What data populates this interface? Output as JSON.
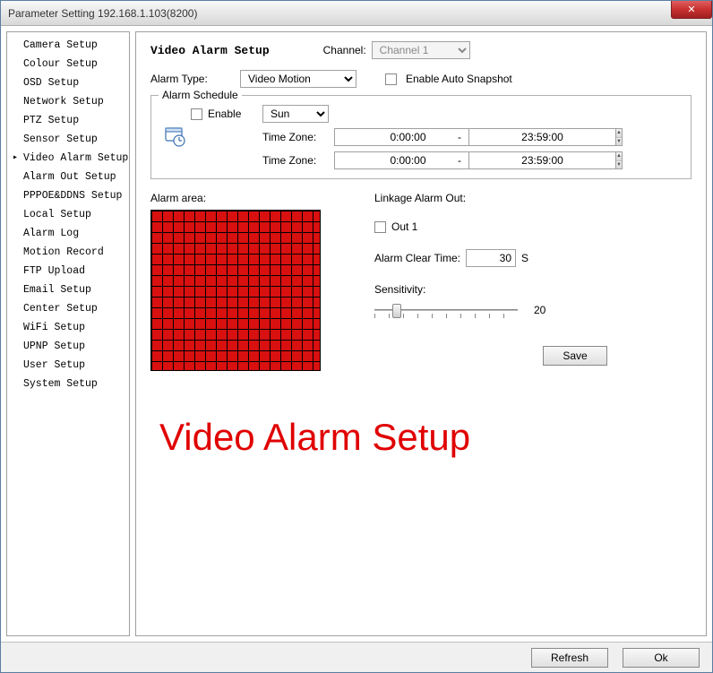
{
  "window": {
    "title": "Parameter Setting 192.168.1.103(8200)"
  },
  "sidebar": {
    "items": [
      {
        "label": "Camera Setup"
      },
      {
        "label": "Colour Setup"
      },
      {
        "label": "OSD Setup"
      },
      {
        "label": "Network Setup"
      },
      {
        "label": "PTZ Setup"
      },
      {
        "label": "Sensor Setup"
      },
      {
        "label": "Video Alarm Setup",
        "selected": true
      },
      {
        "label": "Alarm Out Setup"
      },
      {
        "label": "PPPOE&DDNS Setup"
      },
      {
        "label": "Local Setup"
      },
      {
        "label": "Alarm Log"
      },
      {
        "label": "Motion Record"
      },
      {
        "label": "FTP Upload"
      },
      {
        "label": "Email Setup"
      },
      {
        "label": "Center Setup"
      },
      {
        "label": "WiFi Setup"
      },
      {
        "label": "UPNP Setup"
      },
      {
        "label": "User Setup"
      },
      {
        "label": "System Setup"
      }
    ]
  },
  "main": {
    "title": "Video Alarm Setup",
    "channel_label": "Channel:",
    "channel_value": "Channel 1",
    "alarm_type_label": "Alarm Type:",
    "alarm_type_value": "Video Motion",
    "enable_snapshot_label": "Enable Auto Snapshot",
    "schedule": {
      "legend": "Alarm Schedule",
      "enable_label": "Enable",
      "day_value": "Sun",
      "tz_label": "Time Zone:",
      "tz1_from": "0:00:00",
      "tz1_to": "23:59:00",
      "tz2_from": "0:00:00",
      "tz2_to": "23:59:00",
      "sep": "-"
    },
    "alarm_area_label": "Alarm area:",
    "linkage": {
      "title": "Linkage Alarm Out:",
      "out1_label": "Out 1",
      "clear_label": "Alarm Clear Time:",
      "clear_value": "30",
      "clear_unit": "S",
      "sensitivity_label": "Sensitivity:",
      "sensitivity_value": "20",
      "save_label": "Save"
    },
    "overlay_text": "Video Alarm Setup"
  },
  "footer": {
    "refresh": "Refresh",
    "ok": "Ok"
  }
}
